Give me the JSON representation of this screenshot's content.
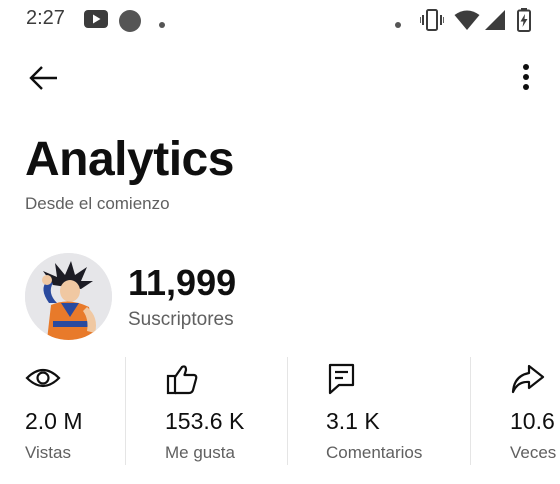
{
  "status_bar": {
    "time": "2:27",
    "icons": [
      "youtube-icon",
      "notification-circle-icon",
      "dot-icon",
      "dot-icon",
      "vibrate-icon",
      "wifi-icon",
      "signal-icon",
      "battery-charging-icon"
    ]
  },
  "app_bar": {
    "back_icon": "arrow-back-icon",
    "menu_icon": "more-vert-icon"
  },
  "header": {
    "title": "Analytics",
    "subtitle": "Desde el comienzo"
  },
  "channel": {
    "subscribers": "11,999",
    "subscribers_label": "Suscriptores"
  },
  "stats": [
    {
      "icon": "eye-icon",
      "value": "2.0 M",
      "label": "Vistas"
    },
    {
      "icon": "thumbs-up-icon",
      "value": "153.6 K",
      "label": "Me gusta"
    },
    {
      "icon": "comment-icon",
      "value": "3.1 K",
      "label": "Comentarios"
    },
    {
      "icon": "share-icon",
      "value": "10.6",
      "label": "Veces"
    }
  ],
  "colors": {
    "text_primary": "#0f0f0f",
    "text_secondary": "#606060",
    "divider": "#e5e5e5",
    "background": "#ffffff"
  }
}
